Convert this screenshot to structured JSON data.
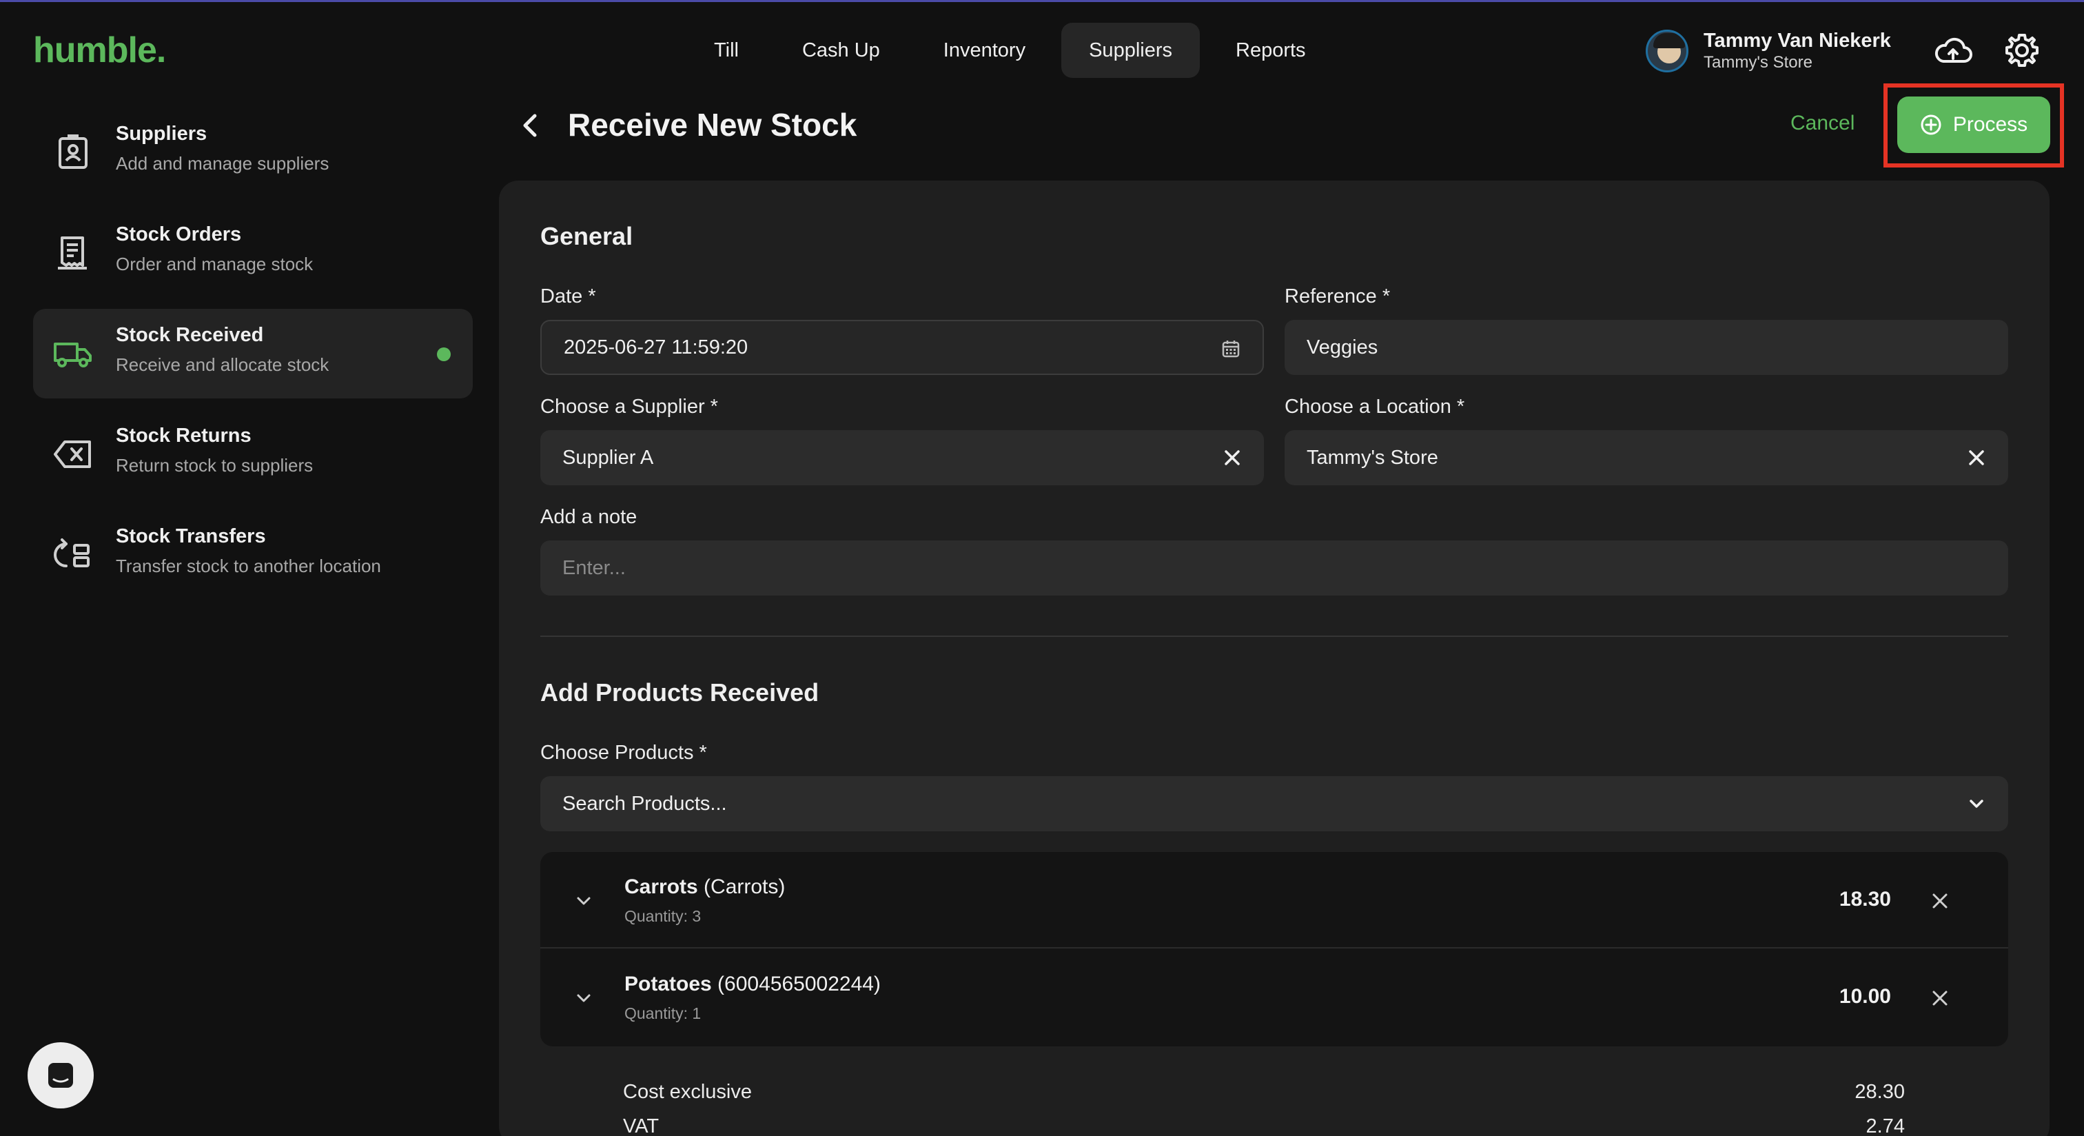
{
  "app": {
    "logo": "humble."
  },
  "nav": {
    "tabs": [
      {
        "label": "Till",
        "active": false
      },
      {
        "label": "Cash Up",
        "active": false
      },
      {
        "label": "Inventory",
        "active": false
      },
      {
        "label": "Suppliers",
        "active": true
      },
      {
        "label": "Reports",
        "active": false
      }
    ]
  },
  "user": {
    "name": "Tammy Van Niekerk",
    "store": "Tammy's Store"
  },
  "icons": {
    "sync": "cloud-upload-icon",
    "settings": "gear-icon"
  },
  "sidebar": {
    "items": [
      {
        "title": "Suppliers",
        "subtitle": "Add and manage suppliers",
        "icon": "supplier-contact-icon",
        "active": false
      },
      {
        "title": "Stock Orders",
        "subtitle": "Order and manage stock",
        "icon": "receipt-icon",
        "active": false
      },
      {
        "title": "Stock Received",
        "subtitle": "Receive and allocate stock",
        "icon": "truck-icon",
        "active": true
      },
      {
        "title": "Stock Returns",
        "subtitle": "Return stock to suppliers",
        "icon": "return-icon",
        "active": false
      },
      {
        "title": "Stock Transfers",
        "subtitle": "Transfer stock to another location",
        "icon": "transfer-icon",
        "active": false
      }
    ]
  },
  "page": {
    "title": "Receive New Stock",
    "cancel_label": "Cancel",
    "process_label": "Process"
  },
  "general": {
    "title": "General",
    "date_label": "Date *",
    "date_value": "2025-06-27 11:59:20",
    "reference_label": "Reference *",
    "reference_value": "Veggies",
    "supplier_label": "Choose a Supplier *",
    "supplier_value": "Supplier A",
    "location_label": "Choose a Location *",
    "location_value": "Tammy's Store",
    "note_label": "Add a note",
    "note_placeholder": "Enter..."
  },
  "products": {
    "title": "Add Products Received",
    "choose_label": "Choose Products *",
    "search_placeholder": "Search Products...",
    "items": [
      {
        "name": "Carrots",
        "code": "(Carrots)",
        "quantity": "Quantity: 3",
        "price": "18.30"
      },
      {
        "name": "Potatoes",
        "code": "(6004565002244)",
        "quantity": "Quantity: 1",
        "price": "10.00"
      }
    ]
  },
  "totals": [
    {
      "label": "Cost exclusive",
      "value": "28.30"
    },
    {
      "label": "VAT",
      "value": "2.74"
    }
  ],
  "colors": {
    "accent": "#5cb85c",
    "highlight": "#e53324",
    "background": "#111111",
    "card": "#1f1f1f"
  }
}
